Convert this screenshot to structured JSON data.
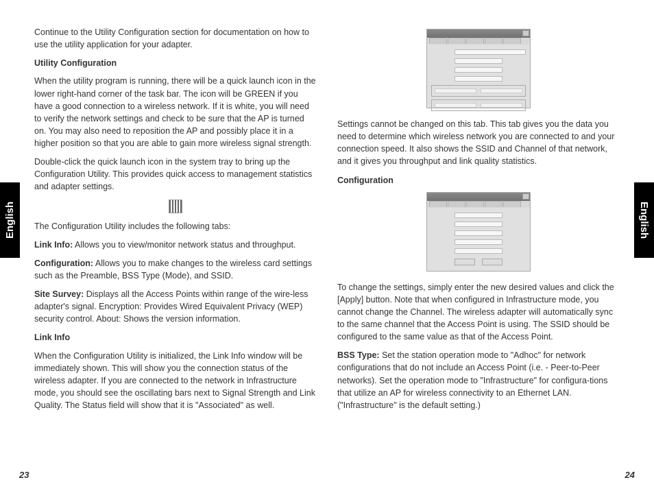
{
  "side_label_left": "English",
  "side_label_right": "English",
  "page_num_left": "23",
  "page_num_right": "24",
  "left": {
    "p_intro": "Continue to the Utility Configuration section for documentation on how to use the utility application for your adapter.",
    "h_utility": "Utility Configuration",
    "p_utility1": "When the utility program is running, there will be a quick launch icon in the lower right-hand corner of the task bar. The icon will be GREEN if you have a good connection to a wireless network. If it is white, you will need to verify the network settings and check to be sure that the AP is turned on. You may also need to reposition the AP and possibly place it in a higher position so that you are able to gain more wireless signal strength.",
    "p_utility2": "Double-click the quick launch icon in the system tray to bring up the Configuration Utility. This provides quick access to management statistics and adapter settings.",
    "p_tabs_intro": "The Configuration Utility includes the following tabs:",
    "b_linkinfo": "Link Info:",
    "p_linkinfo": " Allows you to view/monitor network status and throughput.",
    "b_config": "Configuration:",
    "p_config": " Allows you to make changes to the wireless card settings such as the Preamble, BSS Type (Mode), and SSID.",
    "b_site": "Site Survey:",
    "p_site": " Displays all the Access Points within range of the wire-less adapter's signal. Encryption: Provides Wired Equivalent Privacy (WEP) security control. About: Shows the version information.",
    "h_linkinfo": "Link Info",
    "p_linkinfo_body": "When the Configuration Utility is initialized, the Link Info window will be immediately shown. This will show you the connection status of the wireless adapter. If you are connected to the network in Infrastructure mode, you should see the oscillating bars next to Signal Strength and Link Quality. The Status field will show that it is \"Associated\" as well."
  },
  "right": {
    "p_settings": "Settings cannot be changed on this tab. This tab gives you the data you need to determine which wireless network you are connected to and your connection speed. It also shows the SSID and Channel of that network, and it gives you throughput and link quality statistics.",
    "h_config": "Configuration",
    "p_change": "To change the settings, simply enter the new desired values and click the [Apply] button. Note that when configured in Infrastructure mode, you cannot change the Channel. The wireless adapter will automatically sync to the same channel that the Access Point is using. The SSID should be configured to the same value as that of the Access Point.",
    "b_bss": "BSS Type:",
    "p_bss": " Set the station operation mode to \"Adhoc\" for network configurations that do not include an Access Point (i.e. - Peer-to-Peer networks). Set the operation mode to \"Infrastructure\" for configura-tions that utilize an AP for wireless connectivity to an Ethernet LAN. (\"Infrastructure\" is the default setting.)"
  },
  "fig1_name": "link-info-dialog-figure",
  "fig2_name": "configuration-dialog-figure",
  "icon_name": "tray-bars-icon"
}
